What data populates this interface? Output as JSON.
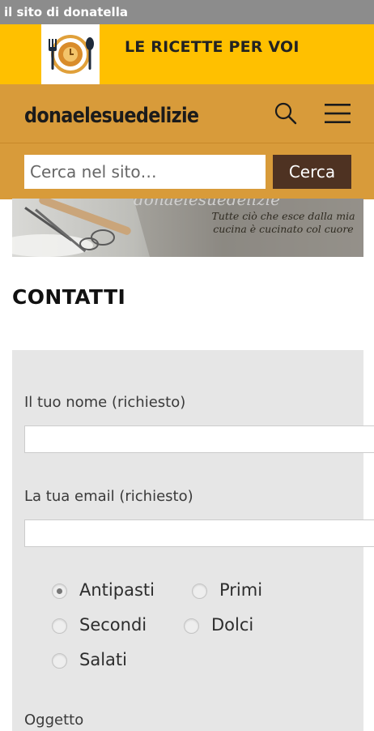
{
  "window": {
    "title": "il sito di donatella"
  },
  "banner": {
    "slogan": "LE RICETTE PER VOI",
    "logo_icon": "plate-fork-spoon-icon"
  },
  "header": {
    "brand": "donaelesuedelizie",
    "search_icon": "search-icon",
    "menu_icon": "hamburger-menu-icon"
  },
  "search": {
    "placeholder": "Cerca nel sito…",
    "button_label": "Cerca"
  },
  "hero": {
    "image": "kitchen-utensils-banner",
    "title": "donaelesuedelizie",
    "subtitle": "Tutte ciò che esce dalla mia cucina è cucinato col cuore"
  },
  "page": {
    "title": "CONTATTI"
  },
  "form": {
    "name_label": "Il tuo nome (richiesto)",
    "email_label": "La tua email (richiesto)",
    "subject_label": "Oggetto",
    "radios": [
      "Antipasti",
      "Primi",
      "Secondi",
      "Dolci",
      "Salati"
    ],
    "selected_radio": "Antipasti"
  },
  "colors": {
    "statusbar": "#8c8c8c",
    "banner": "#ffc000",
    "header": "#d89b3a",
    "search_button": "#4e3222",
    "form_background": "#e6e6e6"
  }
}
